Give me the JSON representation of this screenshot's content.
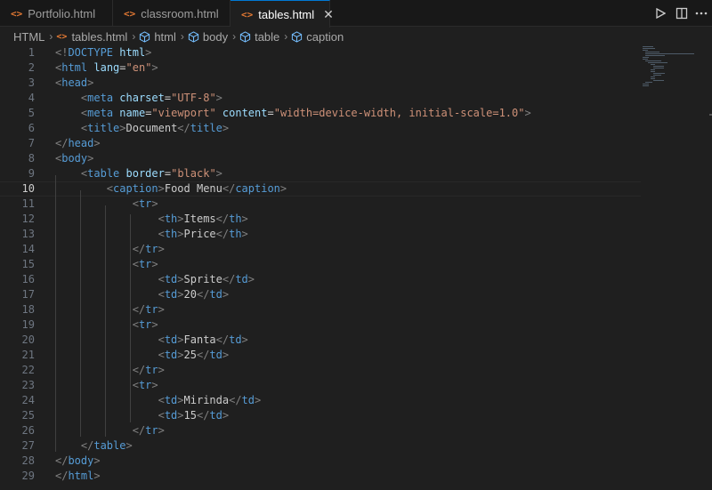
{
  "tabs": [
    {
      "label": "Portfolio.html",
      "icon": "html-file-icon"
    },
    {
      "label": "classroom.html",
      "icon": "html-file-icon"
    },
    {
      "label": "tables.html",
      "icon": "html-file-icon",
      "active": true
    }
  ],
  "tab_icon_glyph": "<>",
  "close_glyph": "✕",
  "breadcrumb": {
    "items": [
      "HTML",
      "tables.html",
      "html",
      "body",
      "table",
      "caption"
    ]
  },
  "editor": {
    "current_line": 10,
    "lines": [
      {
        "n": "1",
        "t": [
          [
            "g",
            "<!"
          ],
          [
            "t",
            "DOCTYPE"
          ],
          [
            "x",
            " "
          ],
          [
            "a",
            "html"
          ],
          [
            "g",
            ">"
          ]
        ]
      },
      {
        "n": "2",
        "t": [
          [
            "g",
            "<"
          ],
          [
            "t",
            "html"
          ],
          [
            "x",
            " "
          ],
          [
            "a",
            "lang"
          ],
          [
            "x",
            "="
          ],
          [
            "s",
            "\"en\""
          ],
          [
            "g",
            ">"
          ]
        ]
      },
      {
        "n": "3",
        "t": [
          [
            "g",
            "<"
          ],
          [
            "t",
            "head"
          ],
          [
            "g",
            ">"
          ]
        ]
      },
      {
        "n": "4",
        "t": [
          [
            "x",
            "    "
          ],
          [
            "g",
            "<"
          ],
          [
            "t",
            "meta"
          ],
          [
            "x",
            " "
          ],
          [
            "a",
            "charset"
          ],
          [
            "x",
            "="
          ],
          [
            "s",
            "\"UTF-8\""
          ],
          [
            "g",
            ">"
          ]
        ]
      },
      {
        "n": "5",
        "t": [
          [
            "x",
            "    "
          ],
          [
            "g",
            "<"
          ],
          [
            "t",
            "meta"
          ],
          [
            "x",
            " "
          ],
          [
            "a",
            "name"
          ],
          [
            "x",
            "="
          ],
          [
            "s",
            "\"viewport\""
          ],
          [
            "x",
            " "
          ],
          [
            "a",
            "content"
          ],
          [
            "x",
            "="
          ],
          [
            "s",
            "\"width=device-width, initial-scale=1.0\""
          ],
          [
            "g",
            ">"
          ]
        ]
      },
      {
        "n": "6",
        "t": [
          [
            "x",
            "    "
          ],
          [
            "g",
            "<"
          ],
          [
            "t",
            "title"
          ],
          [
            "g",
            ">"
          ],
          [
            "x",
            "Document"
          ],
          [
            "g",
            "</"
          ],
          [
            "t",
            "title"
          ],
          [
            "g",
            ">"
          ]
        ]
      },
      {
        "n": "7",
        "t": [
          [
            "g",
            "</"
          ],
          [
            "t",
            "head"
          ],
          [
            "g",
            ">"
          ]
        ]
      },
      {
        "n": "8",
        "t": [
          [
            "g",
            "<"
          ],
          [
            "t",
            "body"
          ],
          [
            "g",
            ">"
          ]
        ]
      },
      {
        "n": "9",
        "t": [
          [
            "x",
            "    "
          ],
          [
            "g",
            "<"
          ],
          [
            "t",
            "table"
          ],
          [
            "x",
            " "
          ],
          [
            "a",
            "border"
          ],
          [
            "x",
            "="
          ],
          [
            "s",
            "\"black\""
          ],
          [
            "g",
            ">"
          ]
        ]
      },
      {
        "n": "10",
        "t": [
          [
            "x",
            "        "
          ],
          [
            "g",
            "<"
          ],
          [
            "t",
            "caption"
          ],
          [
            "g",
            ">"
          ],
          [
            "x",
            "Food Menu"
          ],
          [
            "g",
            "</"
          ],
          [
            "t",
            "caption"
          ],
          [
            "g",
            ">"
          ]
        ]
      },
      {
        "n": "11",
        "t": [
          [
            "x",
            "            "
          ],
          [
            "g",
            "<"
          ],
          [
            "t",
            "tr"
          ],
          [
            "g",
            ">"
          ]
        ]
      },
      {
        "n": "12",
        "t": [
          [
            "x",
            "                "
          ],
          [
            "g",
            "<"
          ],
          [
            "t",
            "th"
          ],
          [
            "g",
            ">"
          ],
          [
            "x",
            "Items"
          ],
          [
            "g",
            "</"
          ],
          [
            "t",
            "th"
          ],
          [
            "g",
            ">"
          ]
        ]
      },
      {
        "n": "13",
        "t": [
          [
            "x",
            "                "
          ],
          [
            "g",
            "<"
          ],
          [
            "t",
            "th"
          ],
          [
            "g",
            ">"
          ],
          [
            "x",
            "Price"
          ],
          [
            "g",
            "</"
          ],
          [
            "t",
            "th"
          ],
          [
            "g",
            ">"
          ]
        ]
      },
      {
        "n": "14",
        "t": [
          [
            "x",
            "            "
          ],
          [
            "g",
            "</"
          ],
          [
            "t",
            "tr"
          ],
          [
            "g",
            ">"
          ]
        ]
      },
      {
        "n": "15",
        "t": [
          [
            "x",
            "            "
          ],
          [
            "g",
            "<"
          ],
          [
            "t",
            "tr"
          ],
          [
            "g",
            ">"
          ]
        ]
      },
      {
        "n": "16",
        "t": [
          [
            "x",
            "                "
          ],
          [
            "g",
            "<"
          ],
          [
            "t",
            "td"
          ],
          [
            "g",
            ">"
          ],
          [
            "x",
            "Sprite"
          ],
          [
            "g",
            "</"
          ],
          [
            "t",
            "td"
          ],
          [
            "g",
            ">"
          ]
        ]
      },
      {
        "n": "17",
        "t": [
          [
            "x",
            "                "
          ],
          [
            "g",
            "<"
          ],
          [
            "t",
            "td"
          ],
          [
            "g",
            ">"
          ],
          [
            "x",
            "20"
          ],
          [
            "g",
            "</"
          ],
          [
            "t",
            "td"
          ],
          [
            "g",
            ">"
          ]
        ]
      },
      {
        "n": "18",
        "t": [
          [
            "x",
            "            "
          ],
          [
            "g",
            "</"
          ],
          [
            "t",
            "tr"
          ],
          [
            "g",
            ">"
          ]
        ]
      },
      {
        "n": "19",
        "t": [
          [
            "x",
            "            "
          ],
          [
            "g",
            "<"
          ],
          [
            "t",
            "tr"
          ],
          [
            "g",
            ">"
          ]
        ]
      },
      {
        "n": "20",
        "t": [
          [
            "x",
            "                "
          ],
          [
            "g",
            "<"
          ],
          [
            "t",
            "td"
          ],
          [
            "g",
            ">"
          ],
          [
            "x",
            "Fanta"
          ],
          [
            "g",
            "</"
          ],
          [
            "t",
            "td"
          ],
          [
            "g",
            ">"
          ]
        ]
      },
      {
        "n": "21",
        "t": [
          [
            "x",
            "                "
          ],
          [
            "g",
            "<"
          ],
          [
            "t",
            "td"
          ],
          [
            "g",
            ">"
          ],
          [
            "x",
            "25"
          ],
          [
            "g",
            "</"
          ],
          [
            "t",
            "td"
          ],
          [
            "g",
            ">"
          ]
        ]
      },
      {
        "n": "22",
        "t": [
          [
            "x",
            "            "
          ],
          [
            "g",
            "</"
          ],
          [
            "t",
            "tr"
          ],
          [
            "g",
            ">"
          ]
        ]
      },
      {
        "n": "23",
        "t": [
          [
            "x",
            "            "
          ],
          [
            "g",
            "<"
          ],
          [
            "t",
            "tr"
          ],
          [
            "g",
            ">"
          ]
        ]
      },
      {
        "n": "24",
        "t": [
          [
            "x",
            "                "
          ],
          [
            "g",
            "<"
          ],
          [
            "t",
            "td"
          ],
          [
            "g",
            ">"
          ],
          [
            "x",
            "Mirinda"
          ],
          [
            "g",
            "</"
          ],
          [
            "t",
            "td"
          ],
          [
            "g",
            ">"
          ]
        ]
      },
      {
        "n": "25",
        "t": [
          [
            "x",
            "                "
          ],
          [
            "g",
            "<"
          ],
          [
            "t",
            "td"
          ],
          [
            "g",
            ">"
          ],
          [
            "x",
            "15"
          ],
          [
            "g",
            "</"
          ],
          [
            "t",
            "td"
          ],
          [
            "g",
            ">"
          ]
        ]
      },
      {
        "n": "26",
        "t": [
          [
            "x",
            "            "
          ],
          [
            "g",
            "</"
          ],
          [
            "t",
            "tr"
          ],
          [
            "g",
            ">"
          ]
        ]
      },
      {
        "n": "27",
        "t": [
          [
            "x",
            "    "
          ],
          [
            "g",
            "</"
          ],
          [
            "t",
            "table"
          ],
          [
            "g",
            ">"
          ]
        ]
      },
      {
        "n": "28",
        "t": [
          [
            "g",
            "</"
          ],
          [
            "t",
            "body"
          ],
          [
            "g",
            ">"
          ]
        ]
      },
      {
        "n": "29",
        "t": [
          [
            "g",
            "</"
          ],
          [
            "t",
            "html"
          ],
          [
            "g",
            ">"
          ]
        ]
      }
    ]
  }
}
